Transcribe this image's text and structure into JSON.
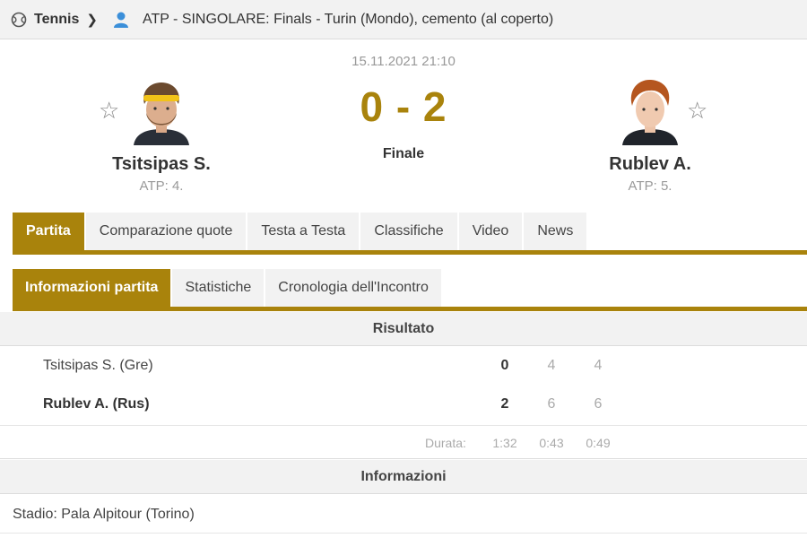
{
  "breadcrumb": {
    "sport": "Tennis",
    "sport_icon": "tennis-ball-icon",
    "category_icon": "person-icon",
    "tournament": "ATP - SINGOLARE: Finals - Turin (Mondo), cemento (al coperto)"
  },
  "match": {
    "datetime": "15.11.2021 21:10",
    "score": "0 - 2",
    "status": "Finale",
    "home": {
      "name": "Tsitsipas S.",
      "rank": "ATP: 4."
    },
    "away": {
      "name": "Rublev A.",
      "rank": "ATP: 5."
    }
  },
  "tabs": [
    "Partita",
    "Comparazione quote",
    "Testa a Testa",
    "Classifiche",
    "Video",
    "News"
  ],
  "subtabs": [
    "Informazioni partita",
    "Statistiche",
    "Cronologia dell'Incontro"
  ],
  "result": {
    "header": "Risultato",
    "rows": [
      {
        "name": "Tsitsipas S. (Gre)",
        "total": "0",
        "set1": "4",
        "set2": "4"
      },
      {
        "name": "Rublev A. (Rus)",
        "total": "2",
        "set1": "6",
        "set2": "6"
      }
    ],
    "duration_label": "Durata:",
    "duration_total": "1:32",
    "duration_set1": "0:43",
    "duration_set2": "0:49"
  },
  "info": {
    "header": "Informazioni",
    "stadium": "Stadio: Pala Alpitour (Torino)"
  },
  "colors": {
    "accent": "#a9830c",
    "tab_bg": "#f2f2f2",
    "muted": "#999999"
  }
}
